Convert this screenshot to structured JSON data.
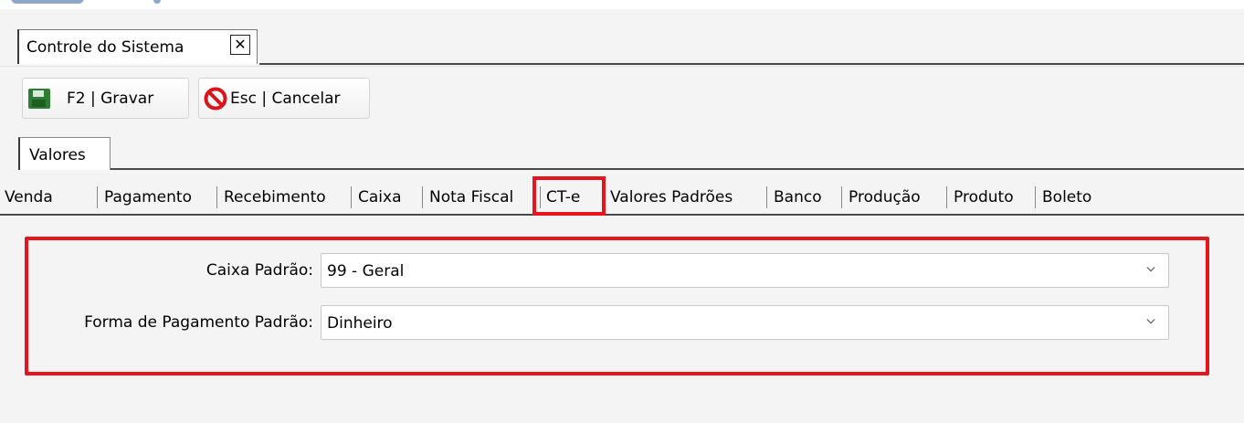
{
  "document_tab": {
    "title": "Controle do Sistema",
    "close_glyph": "✕"
  },
  "toolbar": {
    "save_label": "F2 | Gravar",
    "save_icon": "floppy-disk-icon",
    "cancel_label": "Esc | Cancelar",
    "cancel_icon": "no-entry-icon"
  },
  "section_tab": {
    "label": "Valores"
  },
  "subtabs": {
    "items": [
      "Venda",
      "Pagamento",
      "Recebimento",
      "Caixa",
      "Nota Fiscal",
      "CT-e",
      "Valores Padrões",
      "Banco",
      "Produção",
      "Produto",
      "Boleto"
    ],
    "active": "CT-e"
  },
  "form": {
    "caixa_label": "Caixa Padrão:",
    "caixa_value": "99 - Geral",
    "pagamento_label": "Forma de Pagamento Padrão:",
    "pagamento_value": "Dinheiro"
  },
  "colors": {
    "highlight": "#e8141c",
    "save_icon": "#2f7d32",
    "cancel_icon": "#d9141c"
  }
}
